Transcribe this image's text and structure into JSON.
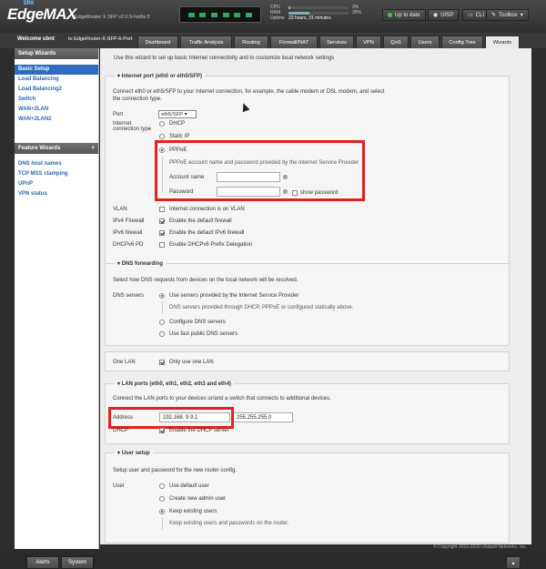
{
  "header": {
    "logo_prefix": "ERX",
    "logo": "EdgeMAX",
    "model": "EdgeRouter X SFP v2.0.9-hotfix.5",
    "stats": [
      {
        "label": "CPU",
        "percent_text": "3%",
        "fill": 0.03
      },
      {
        "label": "RAM",
        "percent_text": "35%",
        "fill": 0.35
      }
    ],
    "uptime_label": "Uptime",
    "uptime_value": "23 hours, 31 minutes",
    "status": "Up to date",
    "uisp": "UISP",
    "cli": "CLI",
    "toolbox": "Toolbox"
  },
  "nav": {
    "welcome": "Welcome ubnt",
    "to_host": "to EdgeRouter-X-SFP-6-Port",
    "tabs": [
      "Dashboard",
      "Traffic Analysis",
      "Routing",
      "Firewall/NAT",
      "Services",
      "VPN",
      "QoS",
      "Users",
      "Config Tree",
      "Wizards"
    ]
  },
  "sidebar": {
    "setup_title": "Setup Wizards",
    "setup_items": [
      "Basic Setup",
      "Load Balancing",
      "Load Balancing2",
      "Switch",
      "WAN+2LAN",
      "WAN+2LAN2"
    ],
    "feature_title": "Feature Wizards",
    "feature_items": [
      "DNS host names",
      "TCP MSS clamping",
      "UPnP",
      "VPN status"
    ]
  },
  "main": {
    "intro": "Use this wizard to set up basic Internet connectivity and to customize local network settings",
    "internet": {
      "title": "Internet port (eth0 or eth5/SFP)",
      "desc1": "Connect eth0 or eth5/SFP to your Internet connection, for example, the cable modem or DSL modem, and select",
      "desc2": "the connection type.",
      "port_label": "Port",
      "port_value": "eth5/SFP",
      "conn_type_label1": "Internet",
      "conn_type_label2": "connection type",
      "dhcp": "DHCP",
      "static_ip": "Static IP",
      "pppoe": "PPPoE",
      "pppoe_desc": "PPPoE account name and password provided by the Internet Service Provider",
      "account_label": "Account name",
      "password_label": "Password",
      "show_password": "show password",
      "vlan_label": "VLAN",
      "vlan_text": "Internet connection is on VLAN",
      "ipv4fw_label": "IPv4 Firewall",
      "ipv4fw_text": "Enable the default firewall",
      "ipv6fw_label": "IPv6 firewall",
      "ipv6fw_text": "Enable the default IPv6 firewall",
      "dhcpv6_label": "DHCPv6 PD",
      "dhcpv6_text": "Enable DHCPv6 Prefix Delegation"
    },
    "dns": {
      "title": "DNS forwarding",
      "desc": "Select how DNS requests from devices on the local network will be resolved.",
      "servers_label": "DNS servers",
      "opt1": "Use servers provided by the Internet Service Provider",
      "opt1_desc": "DNS servers provided through DHCP, PPPoE or configured statically above.",
      "opt2": "Configure DNS servers",
      "opt3": "Use fast public DNS servers"
    },
    "onelan": {
      "label": "One LAN",
      "text": "Only use one LAN"
    },
    "lan": {
      "title": "LAN ports (eth0, eth1, eth2, eth3 and eth4)",
      "desc": "Connect the LAN ports to your devices or/and a switch that connects to additional devices.",
      "address_label": "Address",
      "address": "192.168. 9 9.1",
      "netmask": "255.255.255.0",
      "dhcp_label": "DHCP",
      "dhcp_text": "Enable the DHCP server"
    },
    "user": {
      "title": "User setup",
      "desc": "Setup user and password for the new router config.",
      "label": "User",
      "opt1": "Use default user",
      "opt2": "Create new admin user",
      "opt3": "Keep existing users",
      "opt3_desc": "Keep existing users and passwords on the router."
    }
  },
  "copyright": "© Copyright 2012-2020 Ubiquiti Networks, Inc.",
  "footer": {
    "alerts": "Alerts",
    "system": "System"
  }
}
